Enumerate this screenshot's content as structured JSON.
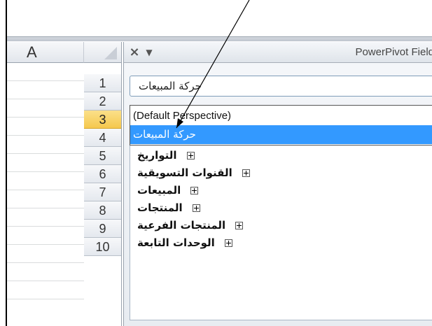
{
  "sheet": {
    "column_header": "A",
    "rows": [
      "1",
      "2",
      "3",
      "4",
      "5",
      "6",
      "7",
      "8",
      "9",
      "10"
    ],
    "active_row": "3"
  },
  "panel": {
    "title": "PowerPivot Field",
    "close_glyph": "×",
    "menu_glyph": "▼",
    "perspective_value": "حركة المبيعات",
    "dropdown_options": [
      "(Default Perspective)",
      "حركة المبيعات"
    ],
    "selected_option": "حركة المبيعات",
    "tables": [
      "التواريخ",
      "القنوات التسويقية",
      "المبيعات",
      "المنتجات",
      "المنتجات الفرعية",
      "الوحدات التابعة"
    ]
  }
}
